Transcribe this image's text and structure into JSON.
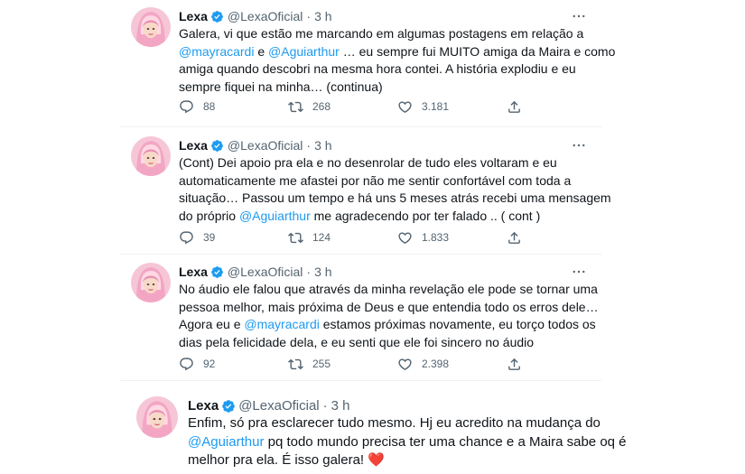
{
  "tweets": [
    {
      "name": "Lexa",
      "handle": "@LexaOficial",
      "dot": "·",
      "time": "3 h",
      "lines": [
        [
          {
            "t": "Galera, vi que estão me marcando em algumas postagens em relação a"
          }
        ],
        [
          {
            "t": "@mayracardi",
            "m": true
          },
          {
            "t": " e "
          },
          {
            "t": "@Aguiarthur",
            "m": true
          },
          {
            "t": " … eu sempre fui MUITO amiga da Maira e como"
          }
        ],
        [
          {
            "t": "amiga quando descobri na mesma hora contei. A história explodiu e eu"
          }
        ],
        [
          {
            "t": "sempre fiquei na minha… (continua)"
          }
        ]
      ],
      "replies": "88",
      "retweets": "268",
      "likes": "3.181"
    },
    {
      "name": "Lexa",
      "handle": "@LexaOficial",
      "dot": "·",
      "time": "3 h",
      "lines": [
        [
          {
            "t": "(Cont) Dei apoio pra ela e no desenrolar de tudo eles voltaram e eu"
          }
        ],
        [
          {
            "t": "automaticamente me afastei por não me sentir confortável com toda a"
          }
        ],
        [
          {
            "t": "situação… Passou um tempo e há uns 5 meses atrás recebi uma mensagem"
          }
        ],
        [
          {
            "t": "do próprio "
          },
          {
            "t": "@Aguiarthur",
            "m": true
          },
          {
            "t": " me agradecendo por ter falado .. ( cont )"
          }
        ]
      ],
      "replies": "39",
      "retweets": "124",
      "likes": "1.833"
    },
    {
      "name": "Lexa",
      "handle": "@LexaOficial",
      "dot": "·",
      "time": "3 h",
      "lines": [
        [
          {
            "t": "No áudio ele falou que através da minha revelação ele pode se tornar uma"
          }
        ],
        [
          {
            "t": "pessoa melhor, mais próxima de Deus e que entendia todo os erros dele…"
          }
        ],
        [
          {
            "t": "Agora eu e "
          },
          {
            "t": "@mayracardi",
            "m": true
          },
          {
            "t": " estamos próximas novamente, eu torço todos os"
          }
        ],
        [
          {
            "t": "dias pela felicidade dela, e eu senti que ele foi sincero no áudio"
          }
        ]
      ],
      "replies": "92",
      "retweets": "255",
      "likes": "2.398"
    },
    {
      "name": "Lexa",
      "handle": "@LexaOficial",
      "dot": "·",
      "time": "3 h",
      "lines": [
        [
          {
            "t": "Enfim, só pra esclarecer tudo mesmo. Hj eu acredito na mudança do"
          }
        ],
        [
          {
            "t": "@Aguiarthur",
            "m": true
          },
          {
            "t": " pq todo mundo precisa ter uma chance e a Maira sabe oq é"
          }
        ],
        [
          {
            "t": "melhor pra ela. É isso galera! "
          },
          {
            "t": "❤️",
            "h": true
          }
        ]
      ]
    }
  ],
  "colors": {
    "mention": "#1d9bf0",
    "verified": "#1d9bf0",
    "heart": "#e0245e",
    "muted": "#536471"
  }
}
